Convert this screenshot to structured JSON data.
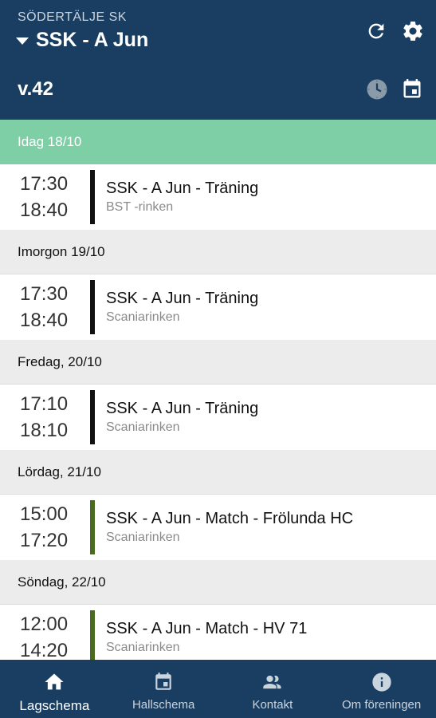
{
  "header": {
    "club_name": "SÖDERTÄLJE SK",
    "team_name": "SSK - A Jun",
    "week_label": "v.42",
    "icons": [
      "refresh-icon",
      "gear-icon",
      "clock-icon",
      "calendar-icon"
    ]
  },
  "colors": {
    "primary": "#1a3e61",
    "today_header": "#7fcfa6",
    "training_bar": "#111111",
    "match_bar": "#4a6b1f"
  },
  "days": [
    {
      "label": "Idag 18/10",
      "today": true,
      "events": [
        {
          "start": "17:30",
          "end": "18:40",
          "title": "SSK - A Jun - Träning",
          "location": "BST -rinken",
          "kind": "training"
        }
      ]
    },
    {
      "label": "Imorgon 19/10",
      "events": [
        {
          "start": "17:30",
          "end": "18:40",
          "title": "SSK - A Jun - Träning",
          "location": "Scaniarinken",
          "kind": "training"
        }
      ]
    },
    {
      "label": "Fredag, 20/10",
      "events": [
        {
          "start": "17:10",
          "end": "18:10",
          "title": "SSK - A Jun - Träning",
          "location": "Scaniarinken",
          "kind": "training"
        }
      ]
    },
    {
      "label": "Lördag, 21/10",
      "events": [
        {
          "start": "15:00",
          "end": "17:20",
          "title": "SSK - A Jun - Match - Frölunda HC",
          "location": "Scaniarinken",
          "kind": "match"
        }
      ]
    },
    {
      "label": "Söndag, 22/10",
      "events": [
        {
          "start": "12:00",
          "end": "14:20",
          "title": "SSK - A Jun - Match - HV 71",
          "location": "Scaniarinken",
          "kind": "match"
        }
      ]
    }
  ],
  "bottom_nav": [
    {
      "label": "Lagschema",
      "icon": "home-icon",
      "active": true
    },
    {
      "label": "Hallschema",
      "icon": "calendar-icon",
      "active": false
    },
    {
      "label": "Kontakt",
      "icon": "people-icon",
      "active": false
    },
    {
      "label": "Om föreningen",
      "icon": "info-icon",
      "active": false
    }
  ]
}
